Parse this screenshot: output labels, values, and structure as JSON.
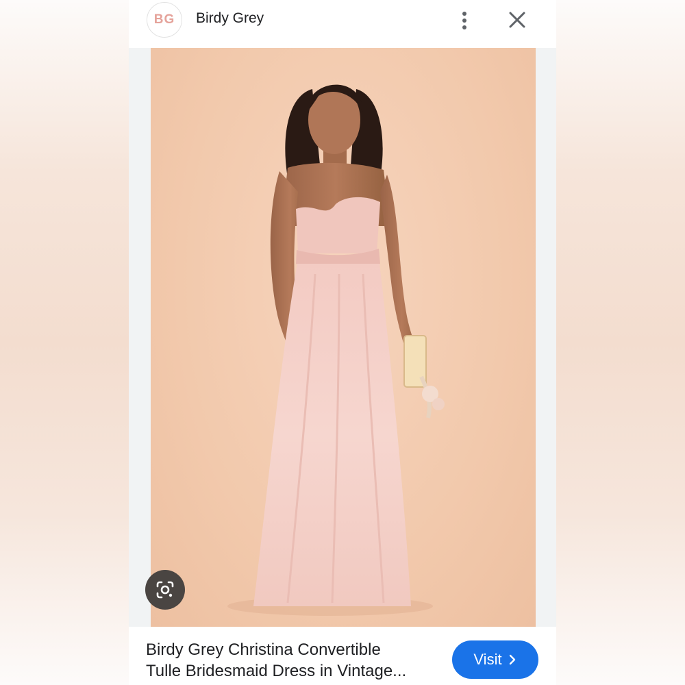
{
  "header": {
    "logo_text": "BG",
    "site_name": "Birdy Grey",
    "more_icon": "more-vert-icon",
    "close_icon": "close-icon"
  },
  "image": {
    "lens_icon": "google-lens-icon"
  },
  "footer": {
    "title_line1": "Birdy Grey Christina Convertible",
    "title_line2": "Tulle Bridesmaid Dress in Vintage...",
    "visit_label": "Visit",
    "visit_icon": "chevron-right-icon"
  },
  "colors": {
    "accent": "#1a73e8",
    "logo": "#e5a39b",
    "backdrop": "#f2c9ac",
    "dress": "#f4cfc8"
  }
}
